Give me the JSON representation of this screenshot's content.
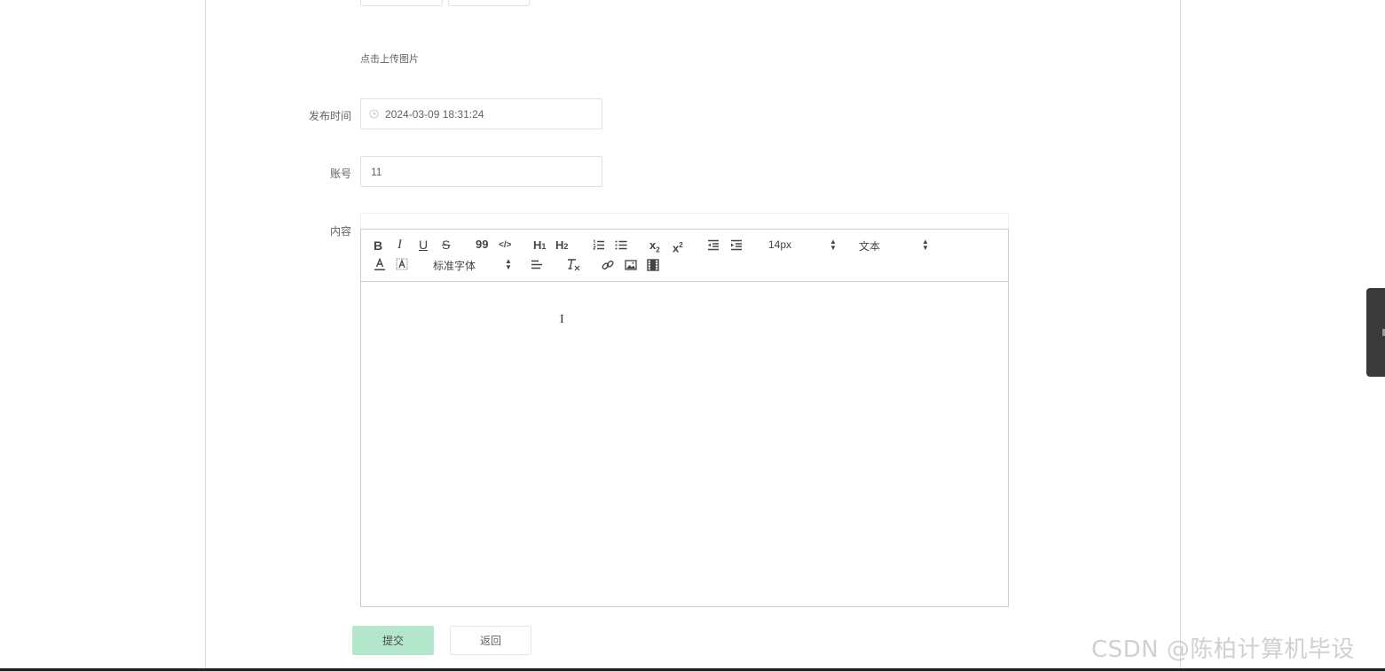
{
  "upload": {
    "hint": "点击上传图片"
  },
  "form": {
    "publish_time": {
      "label": "发布时间",
      "value": "2024-03-09 18:31:24"
    },
    "account": {
      "label": "账号",
      "value": "11"
    },
    "content": {
      "label": "内容"
    }
  },
  "editor": {
    "toolbar": {
      "bold": "B",
      "italic": "I",
      "underline": "U",
      "strike": "S",
      "quote": "99",
      "code": "</>",
      "h1": "H",
      "h1_sub": "1",
      "h2": "H",
      "h2_sub": "2",
      "sub": "x",
      "sub_mark": "2",
      "sup": "x",
      "sup_mark": "2",
      "size_value": "14px",
      "header_value": "文本",
      "font_value": "标准字体"
    },
    "icons": {
      "bold": "bold-icon",
      "italic": "italic-icon",
      "underline": "underline-icon",
      "strike": "strikethrough-icon",
      "quote": "blockquote-icon",
      "code": "code-block-icon",
      "ordered": "ordered-list-icon",
      "bullet": "bullet-list-icon",
      "outdent": "outdent-icon",
      "indent": "indent-icon",
      "color": "font-color-icon",
      "background": "background-color-icon",
      "align": "align-icon",
      "clean": "clear-format-icon",
      "link": "link-icon",
      "image": "image-icon",
      "video": "video-icon"
    }
  },
  "actions": {
    "submit": "提交",
    "back": "返回"
  },
  "watermark": "CSDN @陈柏计算机毕设",
  "colors": {
    "submit_bg": "#b3e6cb",
    "border": "#dcdfe6",
    "text": "#606266"
  }
}
